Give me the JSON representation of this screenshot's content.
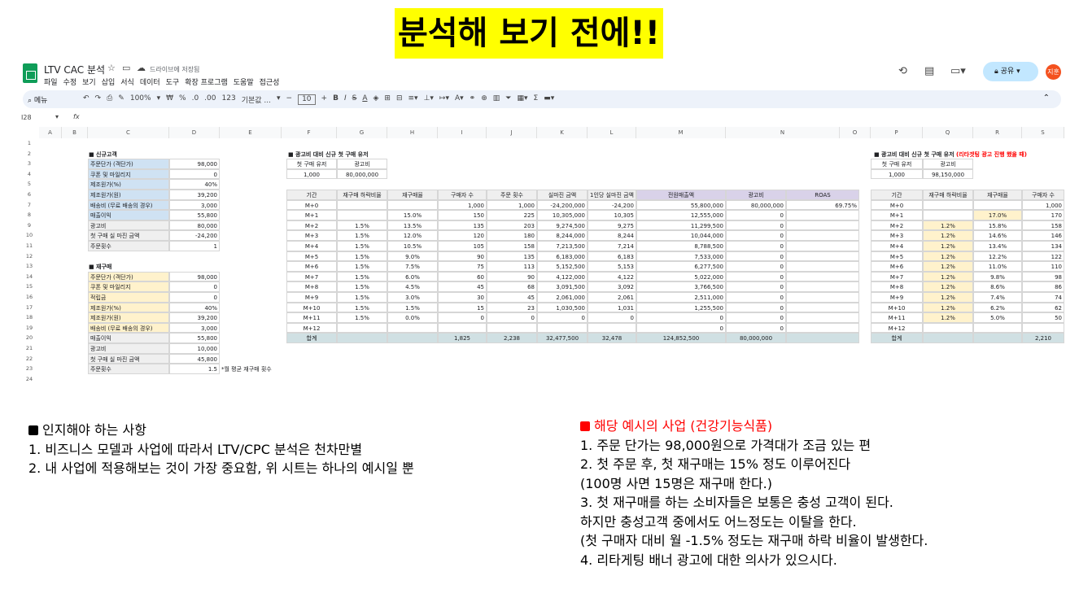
{
  "title": "분석해 보기 전에!!",
  "app": {
    "doc_title": "LTV CAC 분석",
    "save_status": "드라이브에 저장됨",
    "menus": [
      "파일",
      "수정",
      "보기",
      "삽입",
      "서식",
      "데이터",
      "도구",
      "확장 프로그램",
      "도움말",
      "접근성"
    ],
    "share": "공유",
    "avatar": "지훈",
    "search": "메뉴",
    "zoom": "100%",
    "font": "기본값 ...",
    "fontsize": "10",
    "currency": "₩",
    "percent": "%",
    "dec_minus": ".0",
    "dec_plus": ".00",
    "num": "123"
  },
  "formula": {
    "cell_ref": "I28",
    "fx": "fx"
  },
  "columns": [
    "A",
    "B",
    "C",
    "D",
    "E",
    "F",
    "G",
    "H",
    "I",
    "J",
    "K",
    "L",
    "M",
    "N",
    "O",
    "P",
    "Q",
    "R",
    "S"
  ],
  "rows": [
    "1",
    "2",
    "3",
    "4",
    "5",
    "6",
    "7",
    "8",
    "9",
    "10",
    "11",
    "12",
    "13",
    "14",
    "15",
    "16",
    "17",
    "18",
    "19",
    "20",
    "21",
    "22",
    "23",
    "24"
  ],
  "new_customer": {
    "label": "■ 신규고객",
    "rows": [
      [
        "주문단가 (객단가)",
        "98,000"
      ],
      [
        "쿠폰 및 마일리지",
        "0"
      ],
      [
        "제조원가(%)",
        "40%"
      ],
      [
        "제조원가(원)",
        "39,200"
      ],
      [
        "배송비 (무료 배송의 경우)",
        "3,000"
      ],
      [
        "매출이익",
        "55,800"
      ],
      [
        "광고비",
        "80,000"
      ],
      [
        "첫 구매 실 마진 금액",
        "-24,200"
      ],
      [
        "주문횟수",
        "1"
      ]
    ]
  },
  "repurchase": {
    "label": "■ 재구매",
    "rows": [
      [
        "주문단가 (객단가)",
        "98,000"
      ],
      [
        "쿠폰 및 마일리지",
        "0"
      ],
      [
        "적립금",
        "0"
      ],
      [
        "제조원가(%)",
        "40%"
      ],
      [
        "제조원가(원)",
        "39,200"
      ],
      [
        "배송비 (무료 배송의 경우)",
        "3,000"
      ],
      [
        "매출이익",
        "55,800"
      ],
      [
        "광고비",
        "10,000"
      ],
      [
        "첫 구매 실 마진 금액",
        "45,800"
      ],
      [
        "주문횟수",
        "1.5"
      ]
    ],
    "note": "*월 평균 재구매 횟수"
  },
  "ad1": {
    "label": "■ 광고비 대비 신규 첫 구매 유저",
    "h": [
      "첫 구매 유저",
      "광고비"
    ],
    "v": [
      "1,000",
      "80,000,000"
    ]
  },
  "main_table": {
    "headers": [
      "기간",
      "재구매 하락비율",
      "재구매율",
      "구매자 수",
      "주문 횟수",
      "실마진 금액",
      "1인당 실마진 금액",
      "전원매출액",
      "광고비",
      "ROAS"
    ],
    "rows": [
      [
        "M+0",
        "",
        "",
        "1,000",
        "1,000",
        "-24,200,000",
        "-24,200",
        "55,800,000",
        "80,000,000",
        "69.75%"
      ],
      [
        "M+1",
        "",
        "15.0%",
        "150",
        "225",
        "10,305,000",
        "10,305",
        "12,555,000",
        "0",
        ""
      ],
      [
        "M+2",
        "1.5%",
        "13.5%",
        "135",
        "203",
        "9,274,500",
        "9,275",
        "11,299,500",
        "0",
        ""
      ],
      [
        "M+3",
        "1.5%",
        "12.0%",
        "120",
        "180",
        "8,244,000",
        "8,244",
        "10,044,000",
        "0",
        ""
      ],
      [
        "M+4",
        "1.5%",
        "10.5%",
        "105",
        "158",
        "7,213,500",
        "7,214",
        "8,788,500",
        "0",
        ""
      ],
      [
        "M+5",
        "1.5%",
        "9.0%",
        "90",
        "135",
        "6,183,000",
        "6,183",
        "7,533,000",
        "0",
        ""
      ],
      [
        "M+6",
        "1.5%",
        "7.5%",
        "75",
        "113",
        "5,152,500",
        "5,153",
        "6,277,500",
        "0",
        ""
      ],
      [
        "M+7",
        "1.5%",
        "6.0%",
        "60",
        "90",
        "4,122,000",
        "4,122",
        "5,022,000",
        "0",
        ""
      ],
      [
        "M+8",
        "1.5%",
        "4.5%",
        "45",
        "68",
        "3,091,500",
        "3,092",
        "3,766,500",
        "0",
        ""
      ],
      [
        "M+9",
        "1.5%",
        "3.0%",
        "30",
        "45",
        "2,061,000",
        "2,061",
        "2,511,000",
        "0",
        ""
      ],
      [
        "M+10",
        "1.5%",
        "1.5%",
        "15",
        "23",
        "1,030,500",
        "1,031",
        "1,255,500",
        "0",
        ""
      ],
      [
        "M+11",
        "1.5%",
        "0.0%",
        "0",
        "0",
        "0",
        "0",
        "0",
        "0",
        ""
      ],
      [
        "M+12",
        "",
        "",
        "",
        "",
        "",
        "",
        "0",
        "0",
        ""
      ]
    ],
    "total": [
      "합계",
      "",
      "",
      "1,825",
      "2,238",
      "32,477,500",
      "32,478",
      "124,852,500",
      "80,000,000",
      ""
    ]
  },
  "ad2": {
    "label": "■ 광고비 대비 신규 첫 구매 유저",
    "label_red": "(리타겟팅 광고 진행 했을 때)",
    "h": [
      "첫 구매 유저",
      "광고비"
    ],
    "v": [
      "1,000",
      "98,150,000"
    ]
  },
  "right_table": {
    "headers": [
      "기간",
      "재구매 하락비율",
      "재구매율",
      "구매자 수"
    ],
    "rows": [
      [
        "M+0",
        "",
        "",
        "1,000"
      ],
      [
        "M+1",
        "",
        "17.0%",
        "170"
      ],
      [
        "M+2",
        "1.2%",
        "15.8%",
        "158"
      ],
      [
        "M+3",
        "1.2%",
        "14.6%",
        "146"
      ],
      [
        "M+4",
        "1.2%",
        "13.4%",
        "134"
      ],
      [
        "M+5",
        "1.2%",
        "12.2%",
        "122"
      ],
      [
        "M+6",
        "1.2%",
        "11.0%",
        "110"
      ],
      [
        "M+7",
        "1.2%",
        "9.8%",
        "98"
      ],
      [
        "M+8",
        "1.2%",
        "8.6%",
        "86"
      ],
      [
        "M+9",
        "1.2%",
        "7.4%",
        "74"
      ],
      [
        "M+10",
        "1.2%",
        "6.2%",
        "62"
      ],
      [
        "M+11",
        "1.2%",
        "5.0%",
        "50"
      ],
      [
        "M+12",
        "",
        "",
        ""
      ]
    ],
    "total": [
      "합계",
      "",
      "",
      "2,210"
    ]
  },
  "left_notes": {
    "heading": "인지해야 하는 사항",
    "lines": [
      "1. 비즈니스 모델과 사업에 따라서 LTV/CPC 분석은 천차만별",
      "2. 내 사업에 적용해보는 것이 가장 중요함, 위 시트는 하나의 예시일 뿐"
    ]
  },
  "right_notes": {
    "heading": "해당 예시의 사업 (건강기능식품)",
    "lines": [
      "1. 주문 단가는 98,000원으로 가격대가 조금 있는 편",
      "2. 첫 주문 후, 첫 재구매는 15% 정도 이루어진다",
      "(100명 사면 15명은 재구매 한다.)",
      "3. 첫 재구매를 하는 소비자들은 보통은 충성 고객이 된다.",
      "하지만 충성고객 중에서도 어느정도는 이탈을 한다.",
      "(첫 구매자 대비 월 -1.5% 정도는 재구매 하락 비율이 발생한다.",
      "4. 리타게팅 배너 광고에 대한 의사가 있으시다."
    ]
  }
}
